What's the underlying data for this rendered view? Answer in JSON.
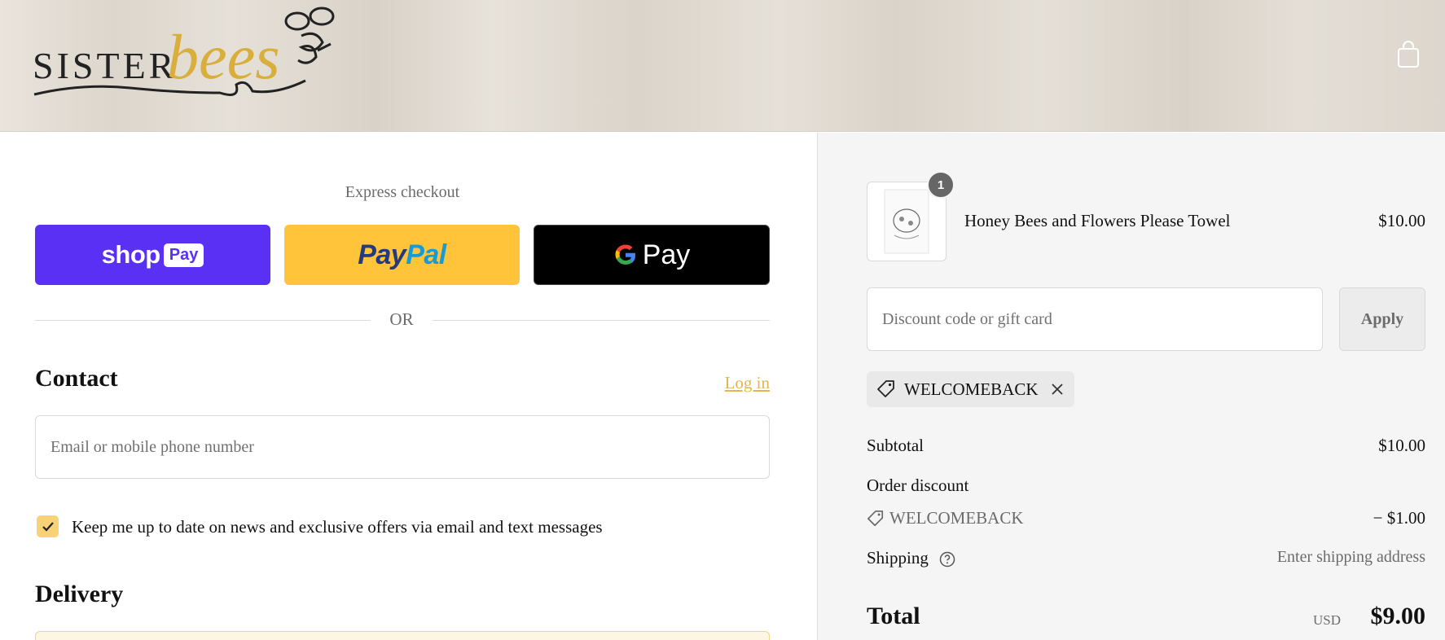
{
  "header": {
    "logo_text_main": "SISTER",
    "logo_text_script": "bees",
    "cart_icon": "shopping-bag-icon"
  },
  "express": {
    "title": "Express checkout",
    "shop_pay_word": "shop",
    "shop_pay_badge": "Pay",
    "paypal_a": "Pay",
    "paypal_b": "Pal",
    "gpay_word": "Pay",
    "or_label": "OR"
  },
  "contact": {
    "heading": "Contact",
    "login_link": "Log in",
    "email_placeholder": "Email or mobile phone number",
    "marketing_checked": true,
    "marketing_label": "Keep me up to date on news and exclusive offers via email and text messages"
  },
  "delivery": {
    "heading": "Delivery"
  },
  "order": {
    "item": {
      "quantity": "1",
      "name": "Honey Bees and Flowers Please Towel",
      "price": "$10.00"
    },
    "discount_placeholder": "Discount code or gift card",
    "apply_label": "Apply",
    "applied_code": "WELCOMEBACK",
    "subtotal_label": "Subtotal",
    "subtotal_value": "$10.00",
    "order_discount_label": "Order discount",
    "order_discount_code": "WELCOMEBACK",
    "order_discount_value": "− $1.00",
    "shipping_label": "Shipping",
    "shipping_value": "Enter shipping address",
    "total_label": "Total",
    "total_currency": "USD",
    "total_value": "$9.00"
  },
  "colors": {
    "shop_pay": "#5a31f4",
    "paypal": "#ffc439",
    "gpay": "#000000",
    "accent": "#e3b74a",
    "checkbox": "#f7d277"
  }
}
